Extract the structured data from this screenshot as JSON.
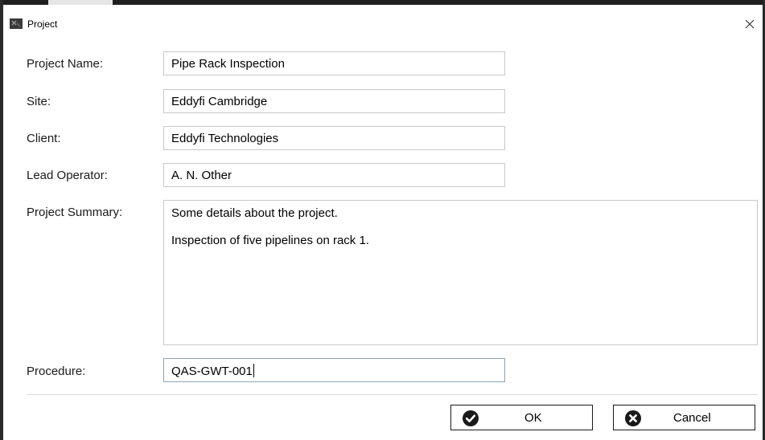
{
  "window": {
    "title": "Project",
    "icon": "app-logo-icon",
    "close_icon": "close-icon"
  },
  "form": {
    "project_name": {
      "label": "Project Name:",
      "value": "Pipe Rack Inspection"
    },
    "site": {
      "label": "Site:",
      "value": "Eddyfi Cambridge"
    },
    "client": {
      "label": "Client:",
      "value": "Eddyfi Technologies"
    },
    "lead_operator": {
      "label": "Lead Operator:",
      "value": "A. N. Other"
    },
    "project_summary": {
      "label": "Project Summary:",
      "lines": [
        "Some details about the project.",
        "Inspection of five pipelines on rack 1."
      ]
    },
    "procedure": {
      "label": "Procedure:",
      "value": "QAS-GWT-001"
    }
  },
  "buttons": {
    "ok": {
      "label": "OK",
      "icon": "checkmark-circle-icon"
    },
    "cancel": {
      "label": "Cancel",
      "icon": "x-circle-icon"
    }
  },
  "colors": {
    "button_icon": "#1a1a1a",
    "field_border": "#c9c9c9",
    "focused_border": "#8fa3b8"
  }
}
